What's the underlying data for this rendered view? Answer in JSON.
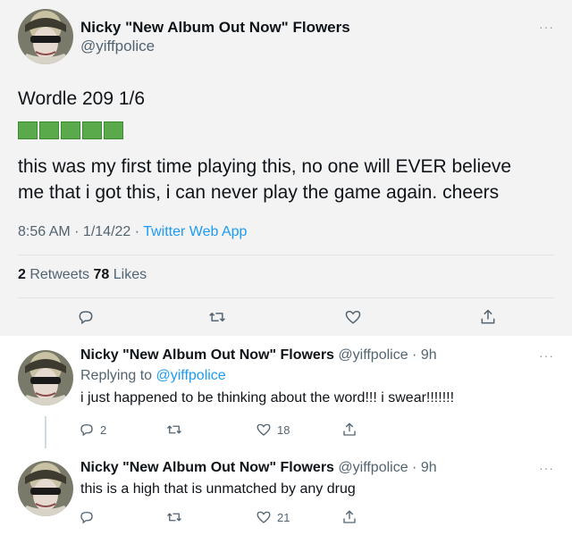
{
  "main_tweet": {
    "author_name": "Nicky \"New Album Out Now\" Flowers",
    "author_handle": "@yiffpolice",
    "more_label": "···",
    "line1": "Wordle 209 1/6",
    "squares": [
      "green",
      "green",
      "green",
      "green",
      "green"
    ],
    "body_line1": "this was my first time playing this, no one will EVER believe",
    "body_line2": "me that i got this, i can never play the game again. cheers",
    "time": "8:56 AM · 1/14/22 · ",
    "source": "Twitter Web App",
    "retweets_count": "2",
    "retweets_label": " Retweets ",
    "likes_count": "78",
    "likes_label": " Likes",
    "icons": [
      "reply-icon",
      "retweet-icon",
      "like-icon",
      "share-icon"
    ]
  },
  "replies": [
    {
      "author_name": "Nicky \"New Album Out Now\" Flowers",
      "author_handle": "@yiffpolice · 9h",
      "replying_prefix": "Replying to ",
      "replying_to": "@yiffpolice",
      "text": "i just happened to be thinking about the word!!! i swear!!!!!!!",
      "reply_count": "2",
      "retweet_count": "",
      "like_count": "18",
      "more_label": "···"
    },
    {
      "author_name": "Nicky \"New Album Out Now\" Flowers",
      "author_handle": "@yiffpolice · 9h",
      "text": "this is a high that is unmatched by any drug",
      "reply_count": "",
      "retweet_count": "",
      "like_count": "21",
      "more_label": "···"
    }
  ],
  "colors": {
    "link": "#1d9bf0",
    "wordle_green": "#5aa94b",
    "main_bg": "#f3f3f4",
    "muted": "#536471"
  }
}
